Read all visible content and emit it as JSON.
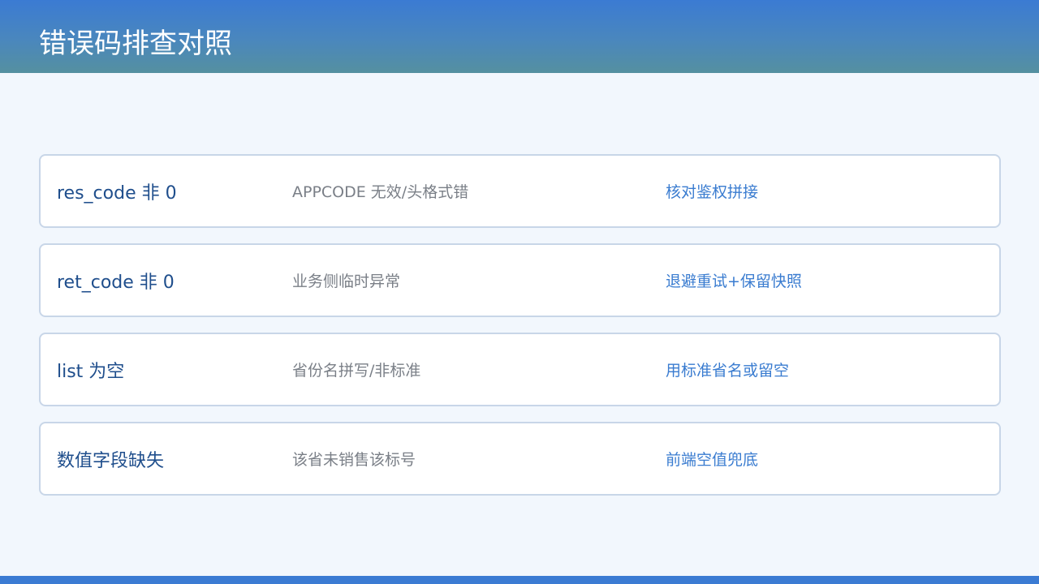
{
  "header": {
    "title": "错误码排查对照",
    "colors": {
      "top": "#3b7bd3",
      "bottom": "#5590a0"
    }
  },
  "rows": [
    {
      "code": "res_code 非 0",
      "cause": "APPCODE 无效/头格式错",
      "action": "核对鉴权拼接"
    },
    {
      "code": "ret_code 非 0",
      "cause": "业务侧临时异常",
      "action": "退避重试+保留快照"
    },
    {
      "code": "list 为空",
      "cause": "省份名拼写/非标准",
      "action": "用标准省名或留空"
    },
    {
      "code": "数值字段缺失",
      "cause": "该省未销售该标号",
      "action": "前端空值兜底"
    }
  ],
  "colors": {
    "background": "#f2f7fd",
    "code_text": "#1f4e8c",
    "cause_text": "#7a7f87",
    "action_text": "#3a7cd0",
    "card_border": "#c8d6e8",
    "footer_bar": "#3b7bd3"
  }
}
